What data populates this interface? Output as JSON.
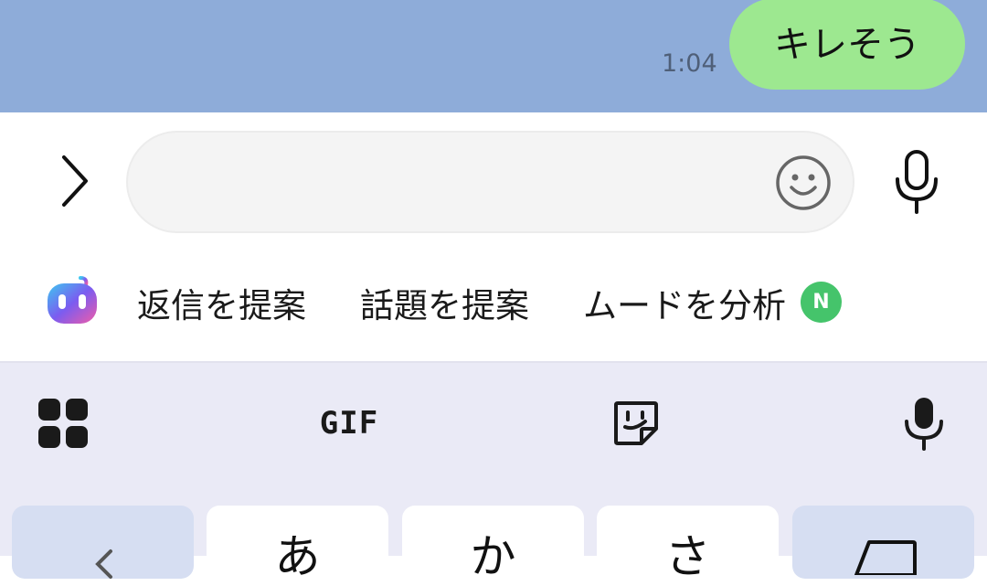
{
  "chat": {
    "message_text": "キレそう",
    "message_time": "1:04",
    "bubble_color": "#9de890",
    "background_color": "#8eacd9"
  },
  "input_bar": {
    "placeholder": "",
    "value": "",
    "expand_icon": "chevron-right-icon",
    "emoji_icon": "smiley-icon",
    "mic_icon": "microphone-icon"
  },
  "ai_suggestions": {
    "logo_icon": "ai-assistant-icon",
    "chips": [
      {
        "label": "返信を提案"
      },
      {
        "label": "話題を提案"
      },
      {
        "label": "ムードを分析"
      }
    ],
    "new_badge": "N",
    "new_badge_color": "#45c46b"
  },
  "keyboard": {
    "toolbar": {
      "apps_icon": "grid-icon",
      "gif_label": "GIF",
      "sticker_icon": "sticker-icon",
      "voice_icon": "microphone-icon"
    },
    "keys": [
      "",
      "あ",
      "か",
      "さ",
      ""
    ]
  }
}
